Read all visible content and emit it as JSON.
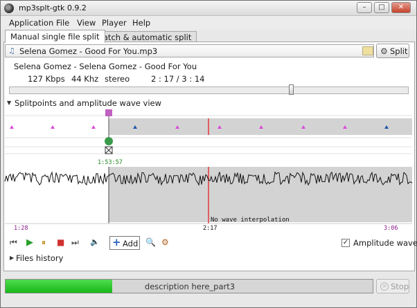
{
  "window": {
    "title": "mp3splt-gtk 0.9.2"
  },
  "title_buttons": {
    "minimize": "–",
    "maximize": "□",
    "close": "✕"
  },
  "menu": [
    "Application",
    "File",
    "View",
    "Player",
    "Help"
  ],
  "tabs": [
    {
      "label": "Manual single file split",
      "active": true
    },
    {
      "label": "Batch & automatic split",
      "active": false
    }
  ],
  "file": {
    "path": "Selena Gomez - Good For You.mp3"
  },
  "split_button": {
    "label": "Split"
  },
  "song": {
    "title": "Selena Gomez - Selena Gomez - Good For You",
    "bitrate": "127 Kbps",
    "frequency": "44 Khz",
    "mode": "stereo",
    "time": "2 : 17 / 3 : 14"
  },
  "position_slider": {
    "fraction": 0.705
  },
  "splitpoints_section": {
    "title": "Splitpoints and amplitude wave view",
    "expanded": true
  },
  "timeline": {
    "cursor_time": "1:53:57",
    "wave_note": "No wave interpolation",
    "ticks": [
      "1:28",
      "2:17",
      "3:06"
    ],
    "colors": {
      "played": "#ffffff",
      "unplayed": "#d3d3d3",
      "playhead": "#e81010",
      "wave": "#111111",
      "splitpoint": "#c060c0",
      "marker": "#1a58a8"
    }
  },
  "player_controls": [
    {
      "name": "previous-icon",
      "glyph": "⏮"
    },
    {
      "name": "play-icon",
      "glyph": "▶"
    },
    {
      "name": "pause-icon",
      "glyph": "⏸"
    },
    {
      "name": "stop-player-icon",
      "glyph": "■"
    },
    {
      "name": "next-icon",
      "glyph": "⏭"
    },
    {
      "name": "volume-icon",
      "glyph": "🔈"
    }
  ],
  "add_button": {
    "label": "Add"
  },
  "amplitude_checkbox": {
    "label": "Amplitude wave",
    "checked": true
  },
  "files_history": {
    "title": "Files history",
    "expanded": false
  },
  "status": {
    "progress_text": "description here_part3",
    "progress": 0.29
  },
  "stop_button": {
    "label": "Stop",
    "enabled": false
  }
}
